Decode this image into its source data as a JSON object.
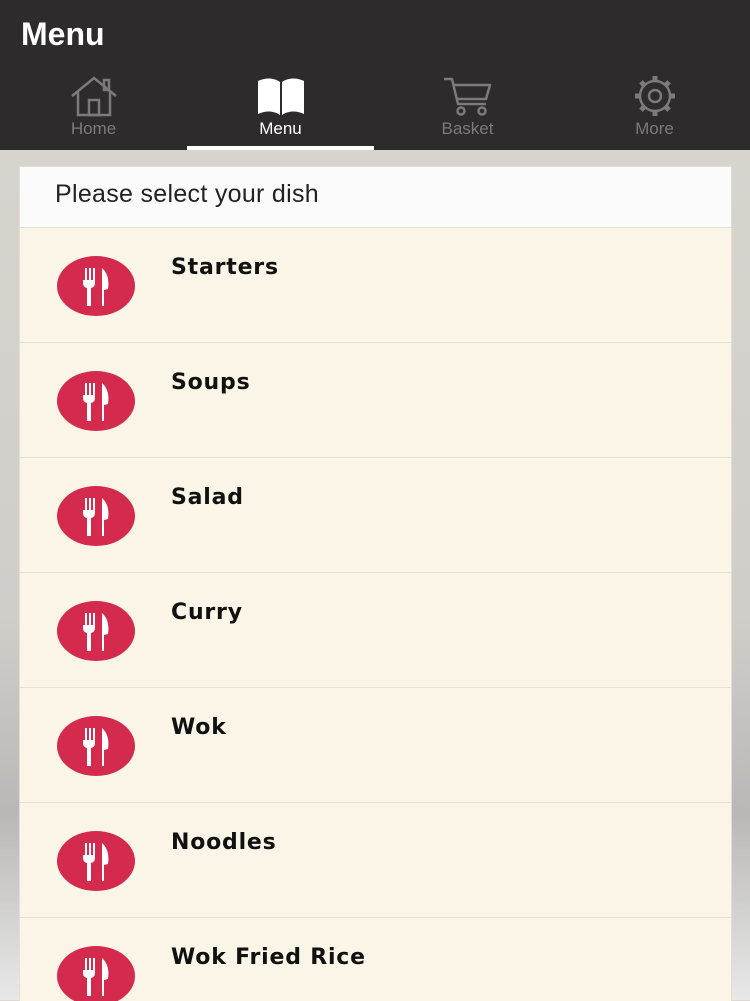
{
  "app": {
    "title": "Menu"
  },
  "tabs": [
    {
      "label": "Home",
      "icon": "home-icon",
      "active": false
    },
    {
      "label": "Menu",
      "icon": "book-icon",
      "active": true
    },
    {
      "label": "Basket",
      "icon": "cart-icon",
      "active": false
    },
    {
      "label": "More",
      "icon": "gear-icon",
      "active": false
    }
  ],
  "panel": {
    "header": "Please select your dish"
  },
  "categories": [
    {
      "label": "Starters",
      "icon": "fork-knife-icon"
    },
    {
      "label": "Soups",
      "icon": "fork-knife-icon"
    },
    {
      "label": "Salad",
      "icon": "fork-knife-icon"
    },
    {
      "label": "Curry",
      "icon": "fork-knife-icon"
    },
    {
      "label": "Wok",
      "icon": "fork-knife-icon"
    },
    {
      "label": "Noodles",
      "icon": "fork-knife-icon"
    },
    {
      "label": "Wok Fried Rice",
      "icon": "fork-knife-icon"
    }
  ],
  "colors": {
    "appbar": "#2d2b2c",
    "accent": "#d42a4e",
    "row_bg": "#faf5e6",
    "inactive_tab": "#7b7b7b"
  }
}
